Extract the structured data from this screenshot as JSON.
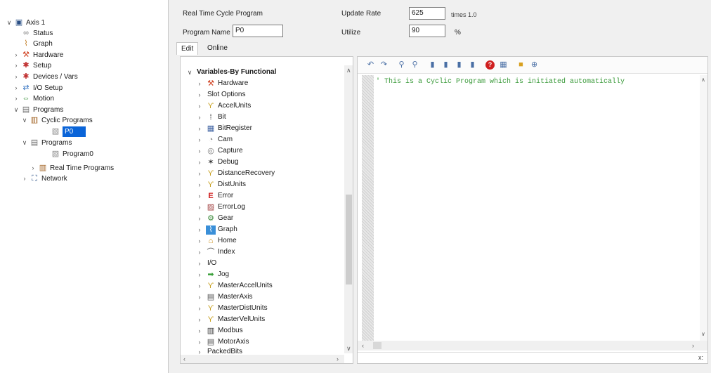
{
  "nav": {
    "items": [
      {
        "label": "Axis 1",
        "toggle": "∨",
        "icon": "axis-icon"
      },
      {
        "label": "Status",
        "toggle": "",
        "icon": "status-icon"
      },
      {
        "label": "Graph",
        "toggle": "",
        "icon": "graph-icon"
      },
      {
        "label": "Hardware",
        "toggle": "›",
        "icon": "hardware-icon"
      },
      {
        "label": "Setup",
        "toggle": "›",
        "icon": "setup-icon"
      },
      {
        "label": "Devices / Vars",
        "toggle": "›",
        "icon": "devices-icon"
      },
      {
        "label": "I/O Setup",
        "toggle": "›",
        "icon": "io-icon"
      },
      {
        "label": "Motion",
        "toggle": "›",
        "icon": "motion-icon"
      },
      {
        "label": "Programs",
        "toggle": "∨",
        "icon": "programs-icon"
      },
      {
        "label": "Cyclic Programs",
        "toggle": "∨",
        "icon": "cyclic-programs-icon"
      },
      {
        "label": "P0",
        "toggle": "",
        "icon": "program-file-icon"
      },
      {
        "label": "Programs",
        "toggle": "∨",
        "icon": "programs-folder-icon"
      },
      {
        "label": "Program0",
        "toggle": "",
        "icon": "program-file-icon"
      },
      {
        "label": "Real Time Programs",
        "toggle": "›",
        "icon": "realtime-programs-icon"
      },
      {
        "label": "Network",
        "toggle": "›",
        "icon": "network-icon"
      }
    ]
  },
  "header": {
    "rt_label": "Real Time Cycle Program",
    "program_name_label": "Program Name",
    "program_name_value": "P0",
    "update_rate_label": "Update Rate",
    "update_rate_value": "625",
    "update_rate_units": "times 1.0",
    "utilize_label": "Utilize",
    "utilize_value": "90",
    "utilize_units": "%",
    "tabs": [
      {
        "label": "Edit"
      },
      {
        "label": "Online"
      }
    ]
  },
  "vars": {
    "header": "Variables-By Functional",
    "items": [
      {
        "label": "Hardware",
        "icon": "hardware-icon"
      },
      {
        "label": "Slot Options",
        "icon": ""
      },
      {
        "label": "AccelUnits",
        "icon": "units-icon"
      },
      {
        "label": "Bit",
        "icon": "bit-icon"
      },
      {
        "label": "BitRegister",
        "icon": "bitregister-icon"
      },
      {
        "label": "Cam",
        "icon": "cam-icon"
      },
      {
        "label": "Capture",
        "icon": "capture-icon"
      },
      {
        "label": "Debug",
        "icon": "debug-icon"
      },
      {
        "label": "DistanceRecovery",
        "icon": "units-icon"
      },
      {
        "label": "DistUnits",
        "icon": "units-icon"
      },
      {
        "label": "Error",
        "icon": "error-icon"
      },
      {
        "label": "ErrorLog",
        "icon": "errorlog-icon"
      },
      {
        "label": "Gear",
        "icon": "gear-icon"
      },
      {
        "label": "Graph",
        "icon": "graph-icon"
      },
      {
        "label": "Home",
        "icon": "home-icon"
      },
      {
        "label": "Index",
        "icon": "index-icon"
      },
      {
        "label": "I/O",
        "icon": ""
      },
      {
        "label": "Jog",
        "icon": "jog-icon"
      },
      {
        "label": "MasterAccelUnits",
        "icon": "units-icon"
      },
      {
        "label": "MasterAxis",
        "icon": "masteraxis-icon"
      },
      {
        "label": "MasterDistUnits",
        "icon": "units-icon"
      },
      {
        "label": "MasterVelUnits",
        "icon": "units-icon"
      },
      {
        "label": "Modbus",
        "icon": "modbus-icon"
      },
      {
        "label": "MotorAxis",
        "icon": "motoraxis-icon"
      },
      {
        "label": "PackedBits",
        "icon": ""
      }
    ]
  },
  "editor": {
    "code": "' This is a Cyclic Program which is initiated automatically",
    "status": "x:"
  },
  "colors": {
    "selection": "#0a64d8",
    "comment_text": "#3a9a3a"
  }
}
